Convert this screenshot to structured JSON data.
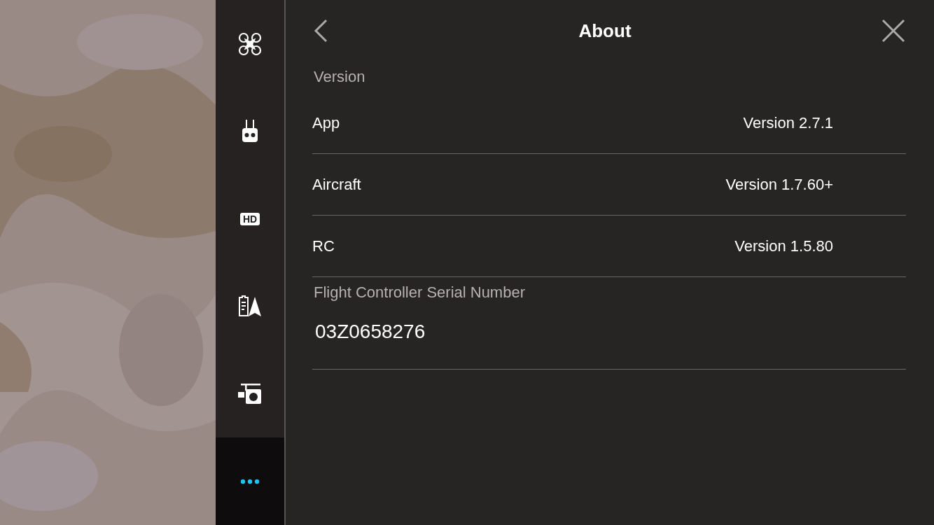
{
  "sidebar": {
    "tabs": [
      {
        "kind": "aircraft",
        "selected": false
      },
      {
        "kind": "remote",
        "selected": false
      },
      {
        "kind": "hd",
        "label": "HD",
        "selected": false
      },
      {
        "kind": "battery",
        "selected": false
      },
      {
        "kind": "gimbal",
        "selected": false
      },
      {
        "kind": "more",
        "selected": true
      }
    ]
  },
  "panel": {
    "title": "About",
    "sections": [
      {
        "heading": "Version",
        "rows": [
          {
            "label": "App",
            "value": "Version 2.7.1"
          },
          {
            "label": "Aircraft",
            "value": "Version 1.7.60+"
          },
          {
            "label": "RC",
            "value": "Version 1.5.80"
          }
        ]
      },
      {
        "heading": "Flight Controller Serial Number",
        "rows": [
          {
            "value": "03Z0658276"
          }
        ]
      }
    ]
  }
}
